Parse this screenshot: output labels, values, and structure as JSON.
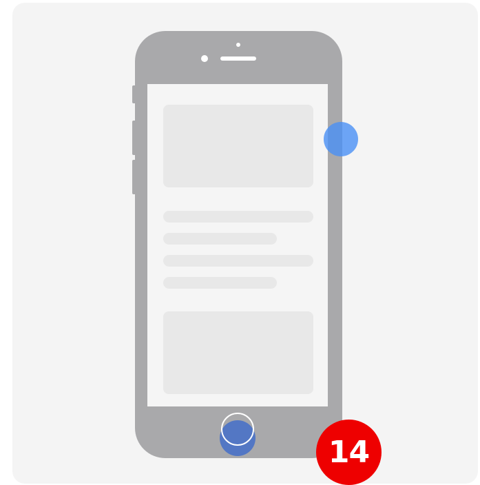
{
  "illustration": {
    "subject": "phone-icon",
    "touch_points": [
      "side-button-touch-icon",
      "home-button-touch-icon"
    ]
  },
  "step_badge": {
    "number": "14",
    "color": "#ee0000"
  },
  "colors": {
    "card_background": "#f4f4f4",
    "phone_body": "#a9a9ab",
    "screen": "#f5f5f5",
    "placeholder": "#e8e8e8",
    "touch_highlight": "#4a90f5"
  }
}
